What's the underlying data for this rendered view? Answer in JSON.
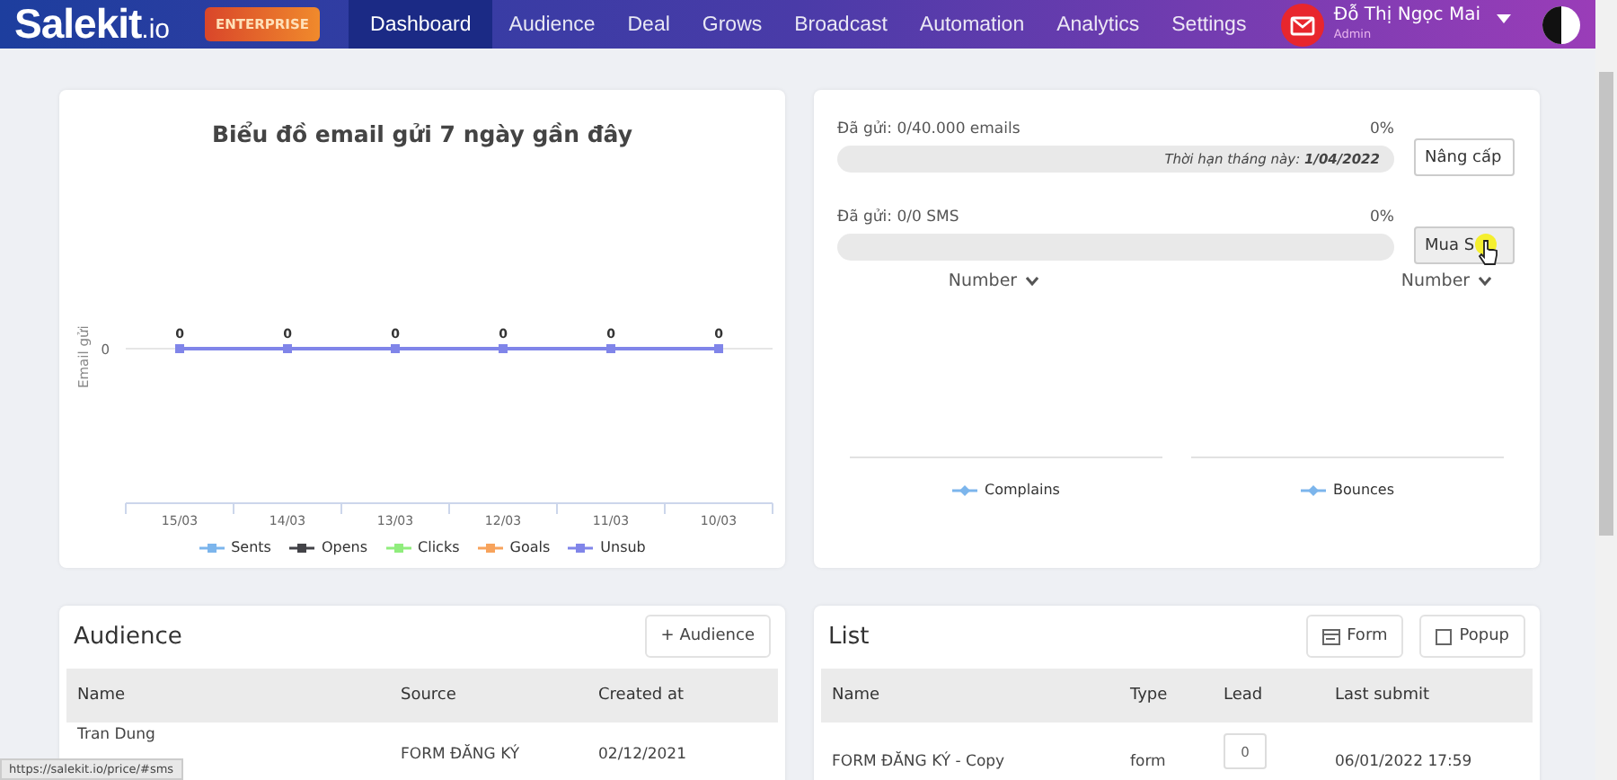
{
  "brand": {
    "name": "Salekit",
    "suffix": ".io",
    "badge": "ENTERPRISE"
  },
  "nav": [
    {
      "label": "Dashboard",
      "selected": true
    },
    {
      "label": "Audience",
      "selected": false
    },
    {
      "label": "Deal",
      "selected": false
    },
    {
      "label": "Grows",
      "selected": false
    },
    {
      "label": "Broadcast",
      "selected": false
    },
    {
      "label": "Automation",
      "selected": false
    },
    {
      "label": "Analytics",
      "selected": false
    },
    {
      "label": "Settings",
      "selected": false
    }
  ],
  "user": {
    "name": "Đỗ Thị Ngọc Mai",
    "role": "Admin"
  },
  "email_chart": {
    "title": "Biểu đồ email gửi 7 ngày gần đây",
    "y_axis_title": "Email gửi",
    "y_tick_label": "0",
    "x_labels": [
      "15/03",
      "14/03",
      "13/03",
      "12/03",
      "11/03",
      "10/03"
    ],
    "point_labels": [
      "0",
      "0",
      "0",
      "0",
      "0",
      "0"
    ],
    "legend": [
      {
        "name": "Sents",
        "color": "#7cb5ec"
      },
      {
        "name": "Opens",
        "color": "#434348"
      },
      {
        "name": "Clicks",
        "color": "#90ed7d"
      },
      {
        "name": "Goals",
        "color": "#f7a35c"
      },
      {
        "name": "Unsub",
        "color": "#8085e9"
      }
    ]
  },
  "quota": [
    {
      "label": "Đã gửi: 0/40.000 emails",
      "reading": "0%",
      "level": 0,
      "note": "Thời hạn tháng này: **1/04/2022**",
      "button": "Nâng cấp"
    },
    {
      "label": "Đã gửi: 0/0 SMS",
      "reading": "0%",
      "level": 0,
      "button": "Mua S"
    }
  ],
  "metrics": [
    {
      "dropdown": "Number",
      "legend": "Complains"
    },
    {
      "dropdown": "Number",
      "legend": "Bounces"
    }
  ],
  "audience": {
    "title": "Audience",
    "add_button": "+ Audience",
    "columns": [
      "Name",
      "Source",
      "Created at"
    ],
    "rows": [
      {
        "name": "Tran Dung",
        "source": "FORM ĐĂNG KÝ",
        "created_at": "02/12/2021"
      }
    ]
  },
  "list": {
    "title": "List",
    "buttons": [
      {
        "kind": "form",
        "label": "Form"
      },
      {
        "kind": "popup",
        "label": "Popup"
      }
    ],
    "columns": [
      "Name",
      "Type",
      "Lead",
      "Last submit"
    ],
    "rows": [
      {
        "name": "FORM ĐĂNG KÝ - Copy",
        "type": "form",
        "lead": "0",
        "last_submit": "06/01/2022 17:59"
      }
    ]
  },
  "status_url": "https://salekit.io/price/#sms"
}
